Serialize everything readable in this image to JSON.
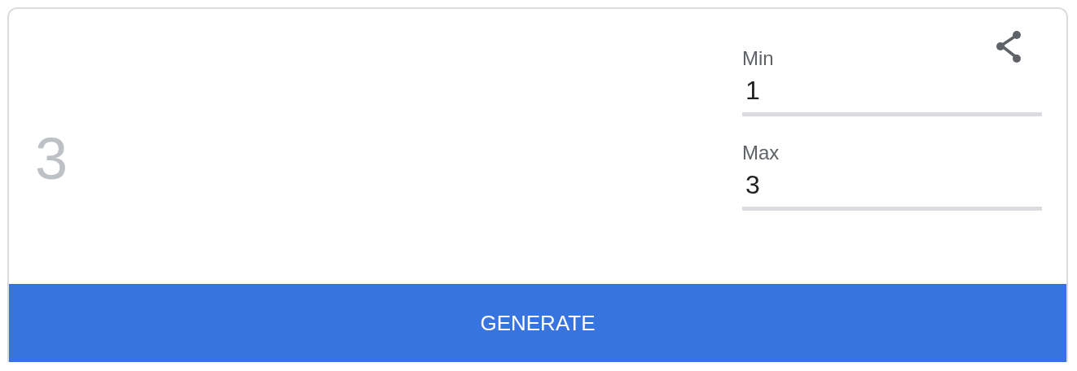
{
  "result": "3",
  "fields": [
    {
      "label": "Min",
      "value": "1"
    },
    {
      "label": "Max",
      "value": "3"
    }
  ],
  "button": "GENERATE"
}
